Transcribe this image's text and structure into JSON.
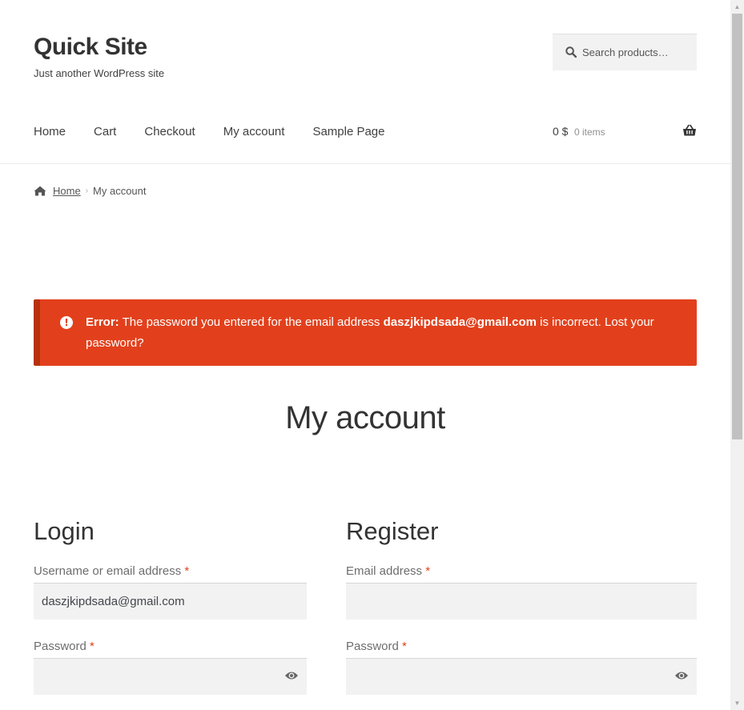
{
  "header": {
    "site_title": "Quick Site",
    "tagline": "Just another WordPress site",
    "search_placeholder": "Search products…"
  },
  "nav": {
    "items": [
      "Home",
      "Cart",
      "Checkout",
      "My account",
      "Sample Page"
    ]
  },
  "cart": {
    "amount": "0 $",
    "count": "0 items"
  },
  "breadcrumb": {
    "home": "Home",
    "current": "My account"
  },
  "error": {
    "label": "Error:",
    "message_before": " The password you entered for the email address ",
    "email": "daszjkipdsada@gmail.com",
    "message_after": " is incorrect. Lost your password?"
  },
  "page_title": "My account",
  "login": {
    "title": "Login",
    "username_label": "Username or email address",
    "username_value": "daszjkipdsada@gmail.com",
    "password_label": "Password",
    "required_mark": "*"
  },
  "register": {
    "title": "Register",
    "email_label": "Email address",
    "password_label": "Password",
    "required_mark": "*"
  },
  "colors": {
    "error_bg": "#e2401c",
    "error_border": "#b8310f",
    "field_bg": "#f2f2f2",
    "required": "#e2401c"
  }
}
